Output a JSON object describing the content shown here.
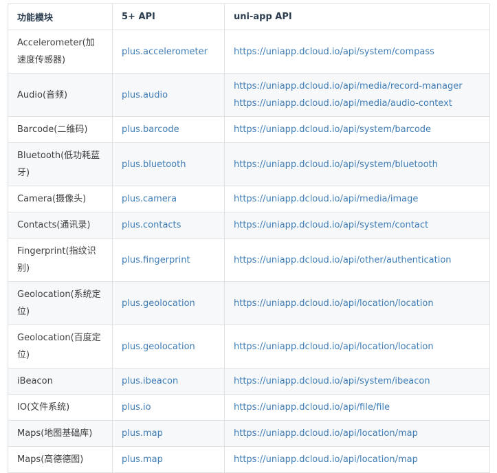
{
  "table": {
    "headers": [
      "功能模块",
      "5+ API",
      "uni-app API"
    ],
    "rows": [
      {
        "module": "Accelerometer(加速度传感器)",
        "plus_api": "plus.accelerometer",
        "uni_api": [
          "https://uniapp.dcloud.io/api/system/compass"
        ]
      },
      {
        "module": "Audio(音频)",
        "plus_api": "plus.audio",
        "uni_api": [
          "https://uniapp.dcloud.io/api/media/record-manager",
          "https://uniapp.dcloud.io/api/media/audio-context"
        ]
      },
      {
        "module": "Barcode(二维码)",
        "plus_api": "plus.barcode",
        "uni_api": [
          "https://uniapp.dcloud.io/api/system/barcode"
        ]
      },
      {
        "module": "Bluetooth(低功耗蓝牙)",
        "plus_api": "plus.bluetooth",
        "uni_api": [
          "https://uniapp.dcloud.io/api/system/bluetooth"
        ]
      },
      {
        "module": "Camera(摄像头)",
        "plus_api": "plus.camera",
        "uni_api": [
          "https://uniapp.dcloud.io/api/media/image"
        ]
      },
      {
        "module": "Contacts(通讯录)",
        "plus_api": "plus.contacts",
        "uni_api": [
          "https://uniapp.dcloud.io/api/system/contact"
        ]
      },
      {
        "module": "Fingerprint(指纹识别)",
        "plus_api": "plus.fingerprint",
        "uni_api": [
          "https://uniapp.dcloud.io/api/other/authentication"
        ]
      },
      {
        "module": "Geolocation(系统定位)",
        "plus_api": "plus.geolocation",
        "uni_api": [
          "https://uniapp.dcloud.io/api/location/location"
        ]
      },
      {
        "module": "Geolocation(百度定位)",
        "plus_api": "plus.geolocation",
        "uni_api": [
          "https://uniapp.dcloud.io/api/location/location"
        ]
      },
      {
        "module": "iBeacon",
        "plus_api": "plus.ibeacon",
        "uni_api": [
          "https://uniapp.dcloud.io/api/system/ibeacon"
        ]
      },
      {
        "module": "IO(文件系统)",
        "plus_api": "plus.io",
        "uni_api": [
          "https://uniapp.dcloud.io/api/file/file"
        ]
      },
      {
        "module": "Maps(地图基础库)",
        "plus_api": "plus.map",
        "uni_api": [
          "https://uniapp.dcloud.io/api/location/map"
        ]
      },
      {
        "module": "Maps(高德德图)",
        "plus_api": "plus.map",
        "uni_api": [
          "https://uniapp.dcloud.io/api/location/map"
        ]
      }
    ]
  },
  "colors": {
    "link": "#3e7cb6",
    "border": "#dfe2e5",
    "stripe": "#f6f8fa",
    "text": "#3d3d3d",
    "header_text": "#2c3e50"
  }
}
